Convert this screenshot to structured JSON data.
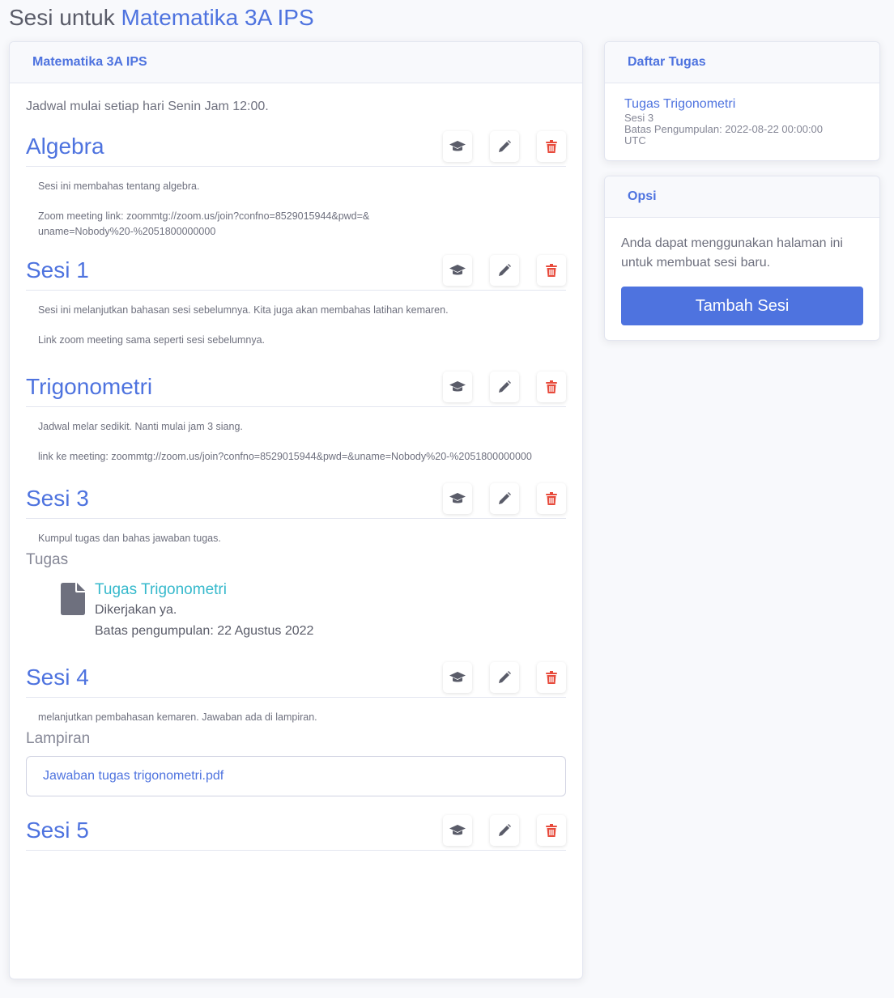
{
  "header": {
    "title_prefix": "Sesi untuk",
    "title_course": "Matematika 3A IPS"
  },
  "main": {
    "card_title": "Matematika 3A IPS",
    "schedule": "Jadwal mulai setiap hari Senin Jam 12:00.",
    "sessions": [
      {
        "title": "Algebra",
        "paragraphs": [
          "Sesi ini membahas tentang algebra.",
          "Zoom meeting link: zoommtg://zoom.us/join?confno=8529015944&pwd=&\nuname=Nobody%20-%2051800000000"
        ]
      },
      {
        "title": "Sesi 1",
        "paragraphs": [
          "Sesi ini melanjutkan bahasan sesi sebelumnya. Kita juga akan membahas latihan kemaren.",
          "Link zoom meeting sama seperti sesi sebelumnya."
        ]
      },
      {
        "title": "Trigonometri",
        "paragraphs": [
          "Jadwal melar sedikit. Nanti mulai jam 3 siang.",
          "link ke meeting: zoommtg://zoom.us/join?confno=8529015944&pwd=&uname=Nobody%20-%2051800000000"
        ]
      },
      {
        "title": "Sesi 3",
        "paragraphs": [
          "Kumpul tugas dan bahas jawaban tugas."
        ],
        "tasks_heading": "Tugas",
        "task": {
          "title": "Tugas Trigonometri",
          "note": "Dikerjakan ya.",
          "deadline": "Batas pengumpulan: 22 Agustus 2022"
        }
      },
      {
        "title": "Sesi 4",
        "paragraphs": [
          "melanjutkan pembahasan kemaren. Jawaban ada di lampiran."
        ],
        "attachments_heading": "Lampiran",
        "attachment": "Jawaban tugas trigonometri.pdf"
      },
      {
        "title": "Sesi 5",
        "paragraphs": []
      }
    ],
    "action_icons": [
      "graduation-cap-icon",
      "pencil-icon",
      "trash-icon"
    ]
  },
  "task_list": {
    "card_title": "Daftar Tugas",
    "items": [
      {
        "title": "Tugas Trigonometri",
        "session": "Sesi 3",
        "deadline": "Batas Pengumpulan: 2022-08-22 00:00:00",
        "tz": "UTC"
      }
    ]
  },
  "options": {
    "card_title": "Opsi",
    "text": "Anda dapat menggunakan halaman ini untuk membuat sesi baru.",
    "button_label": "Tambah Sesi"
  },
  "colors": {
    "primary": "#4e73df",
    "info": "#36b9cc",
    "danger": "#e74a3b",
    "icon_gray": "#5a5c69"
  }
}
